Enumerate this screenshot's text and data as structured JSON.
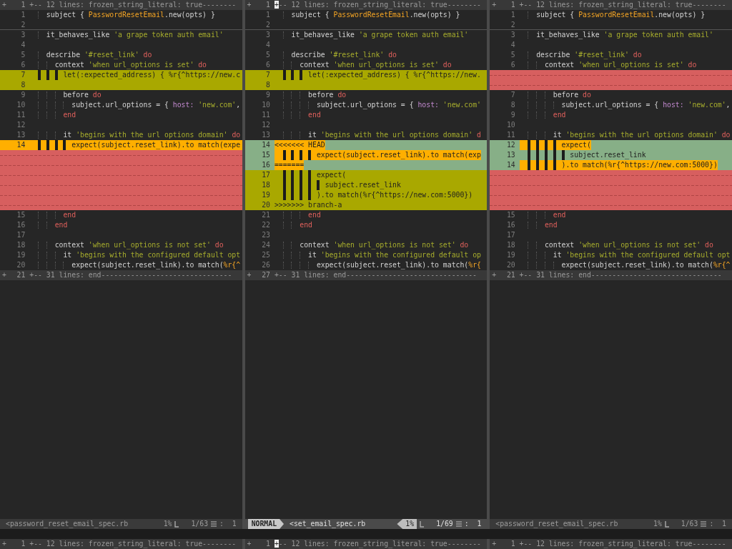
{
  "panes": [
    {
      "fold_top": {
        "marker": "+",
        "num": "1",
        "text": "+-- 12 lines: frozen_string_literal: true--------",
        "cursor": false
      },
      "lines": [
        {
          "kind": "normal",
          "num": "1",
          "tokens": [
            {
              "text": "    subject { ",
              "kind": "plain"
            },
            {
              "text": "PasswordResetEmail",
              "kind": "constant"
            },
            {
              "text": ".new(opts) }",
              "kind": "plain"
            }
          ]
        },
        {
          "kind": "normal",
          "num": "2",
          "cursor_line": true
        },
        {
          "kind": "normal",
          "num": "3",
          "tokens": [
            {
              "text": "    it_behaves_like ",
              "kind": "plain"
            },
            {
              "text": "'a grape token auth email'",
              "kind": "string"
            }
          ]
        },
        {
          "kind": "normal",
          "num": "4"
        },
        {
          "kind": "normal",
          "num": "5",
          "tokens": [
            {
              "text": "    describe ",
              "kind": "plain"
            },
            {
              "text": "'#reset_link' ",
              "kind": "string"
            },
            {
              "text": "do",
              "kind": "keyword"
            }
          ]
        },
        {
          "kind": "normal",
          "num": "6",
          "tokens": [
            {
              "text": "      context ",
              "kind": "plain"
            },
            {
              "text": "'when url_options is set' ",
              "kind": "string"
            },
            {
              "text": "do",
              "kind": "keyword"
            }
          ]
        },
        {
          "kind": "change",
          "num": "7",
          "tokens": [
            {
              "text": "        let(:expected_address) { %r{^https://new.c",
              "kind": "plain"
            }
          ]
        },
        {
          "kind": "change",
          "num": "8"
        },
        {
          "kind": "normal",
          "num": "9",
          "tokens": [
            {
              "text": "        before ",
              "kind": "plain"
            },
            {
              "text": "do",
              "kind": "keyword"
            }
          ]
        },
        {
          "kind": "normal",
          "num": "10",
          "tokens": [
            {
              "text": "          subject.url_options = { ",
              "kind": "plain"
            },
            {
              "text": "host: ",
              "kind": "symbol"
            },
            {
              "text": "'new.com'",
              "kind": "string"
            },
            {
              "text": ",",
              "kind": "plain"
            }
          ]
        },
        {
          "kind": "normal",
          "num": "11",
          "tokens": [
            {
              "text": "        end",
              "kind": "keyword"
            }
          ]
        },
        {
          "kind": "normal",
          "num": "12"
        },
        {
          "kind": "normal",
          "num": "13",
          "tokens": [
            {
              "text": "        it ",
              "kind": "plain"
            },
            {
              "text": "'begins with the url options domain' ",
              "kind": "string"
            },
            {
              "text": "do",
              "kind": "keyword"
            }
          ]
        },
        {
          "kind": "text",
          "num": "14",
          "tokens": [
            {
              "text": "          expect(subject.reset_link).to match(expe",
              "kind": "plain"
            }
          ]
        },
        {
          "kind": "filler"
        },
        {
          "kind": "filler"
        },
        {
          "kind": "filler"
        },
        {
          "kind": "filler"
        },
        {
          "kind": "filler"
        },
        {
          "kind": "filler"
        },
        {
          "kind": "normal",
          "num": "15",
          "tokens": [
            {
              "text": "        end",
              "kind": "keyword"
            }
          ]
        },
        {
          "kind": "normal",
          "num": "16",
          "tokens": [
            {
              "text": "      end",
              "kind": "keyword"
            }
          ]
        },
        {
          "kind": "normal",
          "num": "17"
        },
        {
          "kind": "normal",
          "num": "18",
          "tokens": [
            {
              "text": "      context ",
              "kind": "plain"
            },
            {
              "text": "'when url_options is not set' ",
              "kind": "string"
            },
            {
              "text": "do",
              "kind": "keyword"
            }
          ]
        },
        {
          "kind": "normal",
          "num": "19",
          "tokens": [
            {
              "text": "        it ",
              "kind": "plain"
            },
            {
              "text": "'begins with the configured default opt",
              "kind": "string"
            }
          ]
        },
        {
          "kind": "normal",
          "num": "20",
          "tokens": [
            {
              "text": "          expect(subject.reset_link).to match(",
              "kind": "plain"
            },
            {
              "text": "%r{^",
              "kind": "constant"
            }
          ]
        }
      ],
      "fold_bottom": {
        "marker": "+",
        "num": "21",
        "text": "+-- 31 lines: end-------------------------------",
        "cursor": false
      },
      "status": {
        "active": false,
        "file": "<password_reset_email_spec.rb",
        "percent": "1%",
        "position": "1/63",
        "column": ":  1"
      }
    },
    {
      "fold_top": {
        "marker": "+",
        "num": "1",
        "text": "+-- 12 lines: frozen_string_literal: true--------",
        "cursor": true
      },
      "lines": [
        {
          "kind": "normal",
          "num": "1",
          "tokens": [
            {
              "text": "    subject { ",
              "kind": "plain"
            },
            {
              "text": "PasswordResetEmail",
              "kind": "constant"
            },
            {
              "text": ".new(opts) }",
              "kind": "plain"
            }
          ]
        },
        {
          "kind": "normal",
          "num": "2",
          "cursor_line": true
        },
        {
          "kind": "normal",
          "num": "3",
          "tokens": [
            {
              "text": "    it_behaves_like ",
              "kind": "plain"
            },
            {
              "text": "'a grape token auth email'",
              "kind": "string"
            }
          ]
        },
        {
          "kind": "normal",
          "num": "4"
        },
        {
          "kind": "normal",
          "num": "5",
          "tokens": [
            {
              "text": "    describe ",
              "kind": "plain"
            },
            {
              "text": "'#reset_link' ",
              "kind": "string"
            },
            {
              "text": "do",
              "kind": "keyword"
            }
          ]
        },
        {
          "kind": "normal",
          "num": "6",
          "tokens": [
            {
              "text": "      context ",
              "kind": "plain"
            },
            {
              "text": "'when url_options is set' ",
              "kind": "string"
            },
            {
              "text": "do",
              "kind": "keyword"
            }
          ]
        },
        {
          "kind": "change",
          "num": "7",
          "tokens": [
            {
              "text": "        let(:expected_address) { %r{^https://new.",
              "kind": "plain"
            }
          ]
        },
        {
          "kind": "change",
          "num": "8"
        },
        {
          "kind": "normal",
          "num": "9",
          "tokens": [
            {
              "text": "        before ",
              "kind": "plain"
            },
            {
              "text": "do",
              "kind": "keyword"
            }
          ]
        },
        {
          "kind": "normal",
          "num": "10",
          "tokens": [
            {
              "text": "          subject.url_options = { ",
              "kind": "plain"
            },
            {
              "text": "host: ",
              "kind": "symbol"
            },
            {
              "text": "'new.com'",
              "kind": "string"
            }
          ]
        },
        {
          "kind": "normal",
          "num": "11",
          "tokens": [
            {
              "text": "        end",
              "kind": "keyword"
            }
          ]
        },
        {
          "kind": "normal",
          "num": "12"
        },
        {
          "kind": "normal",
          "num": "13",
          "tokens": [
            {
              "text": "        it ",
              "kind": "plain"
            },
            {
              "text": "'begins with the url options domain' ",
              "kind": "string"
            },
            {
              "text": "d",
              "kind": "keyword"
            }
          ]
        },
        {
          "kind": "conflict",
          "num": "14",
          "text_changed": true,
          "tokens": [
            {
              "text": "<<<<<<< HEAD",
              "kind": "plain"
            }
          ]
        },
        {
          "kind": "conflict",
          "num": "15",
          "text_changed": true,
          "tokens": [
            {
              "text": "          expect(subject.reset_link).to match(exp",
              "kind": "plain"
            }
          ]
        },
        {
          "kind": "conflict",
          "num": "16",
          "text_changed": true,
          "tokens": [
            {
              "text": "=======",
              "kind": "plain"
            }
          ]
        },
        {
          "kind": "change",
          "num": "17",
          "tokens": [
            {
              "text": "          expect(",
              "kind": "plain"
            }
          ]
        },
        {
          "kind": "change",
          "num": "18",
          "tokens": [
            {
              "text": "            subject.reset_link",
              "kind": "plain"
            }
          ]
        },
        {
          "kind": "change",
          "num": "19",
          "tokens": [
            {
              "text": "          ).to match(%r{^https://new.com:5000})",
              "kind": "plain"
            }
          ]
        },
        {
          "kind": "change",
          "num": "20",
          "tokens": [
            {
              "text": ">>>>>>> branch-a",
              "kind": "plain"
            }
          ]
        },
        {
          "kind": "normal",
          "num": "21",
          "tokens": [
            {
              "text": "        end",
              "kind": "keyword"
            }
          ]
        },
        {
          "kind": "normal",
          "num": "22",
          "tokens": [
            {
              "text": "      end",
              "kind": "keyword"
            }
          ]
        },
        {
          "kind": "normal",
          "num": "23"
        },
        {
          "kind": "normal",
          "num": "24",
          "tokens": [
            {
              "text": "      context ",
              "kind": "plain"
            },
            {
              "text": "'when url_options is not set' ",
              "kind": "string"
            },
            {
              "text": "do",
              "kind": "keyword"
            }
          ]
        },
        {
          "kind": "normal",
          "num": "25",
          "tokens": [
            {
              "text": "        it ",
              "kind": "plain"
            },
            {
              "text": "'begins with the configured default op",
              "kind": "string"
            }
          ]
        },
        {
          "kind": "normal",
          "num": "26",
          "tokens": [
            {
              "text": "          expect(subject.reset_link).to match(",
              "kind": "plain"
            },
            {
              "text": "%r{",
              "kind": "constant"
            }
          ]
        }
      ],
      "fold_bottom": {
        "marker": "+",
        "num": "27",
        "text": "+-- 31 lines: end-------------------------------",
        "cursor": false
      },
      "status": {
        "active": true,
        "mode": "NORMAL",
        "file": "<set_email_spec.rb",
        "percent": "1%",
        "position": "1/69",
        "column": ":  1"
      }
    },
    {
      "fold_top": {
        "marker": "+",
        "num": "1",
        "text": "+-- 12 lines: frozen_string_literal: true--------",
        "cursor": false
      },
      "lines": [
        {
          "kind": "normal",
          "num": "1",
          "tokens": [
            {
              "text": "    subject { ",
              "kind": "plain"
            },
            {
              "text": "PasswordResetEmail",
              "kind": "constant"
            },
            {
              "text": ".new(opts) }",
              "kind": "plain"
            }
          ]
        },
        {
          "kind": "normal",
          "num": "2",
          "cursor_line": true
        },
        {
          "kind": "normal",
          "num": "3",
          "tokens": [
            {
              "text": "    it_behaves_like ",
              "kind": "plain"
            },
            {
              "text": "'a grape token auth email'",
              "kind": "string"
            }
          ]
        },
        {
          "kind": "normal",
          "num": "4"
        },
        {
          "kind": "normal",
          "num": "5",
          "tokens": [
            {
              "text": "    describe ",
              "kind": "plain"
            },
            {
              "text": "'#reset_link' ",
              "kind": "string"
            },
            {
              "text": "do",
              "kind": "keyword"
            }
          ]
        },
        {
          "kind": "normal",
          "num": "6",
          "tokens": [
            {
              "text": "      context ",
              "kind": "plain"
            },
            {
              "text": "'when url_options is set' ",
              "kind": "string"
            },
            {
              "text": "do",
              "kind": "keyword"
            }
          ]
        },
        {
          "kind": "filler"
        },
        {
          "kind": "filler"
        },
        {
          "kind": "normal",
          "num": "7",
          "tokens": [
            {
              "text": "        before ",
              "kind": "plain"
            },
            {
              "text": "do",
              "kind": "keyword"
            }
          ]
        },
        {
          "kind": "normal",
          "num": "8",
          "tokens": [
            {
              "text": "          subject.url_options = { ",
              "kind": "plain"
            },
            {
              "text": "host: ",
              "kind": "symbol"
            },
            {
              "text": "'new.com'",
              "kind": "string"
            },
            {
              "text": ",",
              "kind": "plain"
            }
          ]
        },
        {
          "kind": "normal",
          "num": "9",
          "tokens": [
            {
              "text": "        end",
              "kind": "keyword"
            }
          ]
        },
        {
          "kind": "normal",
          "num": "10"
        },
        {
          "kind": "normal",
          "num": "11",
          "tokens": [
            {
              "text": "        it ",
              "kind": "plain"
            },
            {
              "text": "'begins with the url options domain' ",
              "kind": "string"
            },
            {
              "text": "do",
              "kind": "keyword"
            }
          ]
        },
        {
          "kind": "conflict",
          "num": "12",
          "text_changed": true,
          "tokens": [
            {
              "text": "          expect(",
              "kind": "plain"
            }
          ]
        },
        {
          "kind": "conflict",
          "num": "13",
          "text_changed": false,
          "tokens": [
            {
              "text": "            subject.reset_link",
              "kind": "plain"
            }
          ]
        },
        {
          "kind": "conflict",
          "num": "14",
          "text_changed": true,
          "tokens": [
            {
              "text": "          ).to match(%r{^https://new.com:5000})",
              "kind": "plain"
            }
          ]
        },
        {
          "kind": "filler"
        },
        {
          "kind": "filler"
        },
        {
          "kind": "filler"
        },
        {
          "kind": "filler"
        },
        {
          "kind": "normal",
          "num": "15",
          "tokens": [
            {
              "text": "        end",
              "kind": "keyword"
            }
          ]
        },
        {
          "kind": "normal",
          "num": "16",
          "tokens": [
            {
              "text": "      end",
              "kind": "keyword"
            }
          ]
        },
        {
          "kind": "normal",
          "num": "17"
        },
        {
          "kind": "normal",
          "num": "18",
          "tokens": [
            {
              "text": "      context ",
              "kind": "plain"
            },
            {
              "text": "'when url_options is not set' ",
              "kind": "string"
            },
            {
              "text": "do",
              "kind": "keyword"
            }
          ]
        },
        {
          "kind": "normal",
          "num": "19",
          "tokens": [
            {
              "text": "        it ",
              "kind": "plain"
            },
            {
              "text": "'begins with the configured default opt",
              "kind": "string"
            }
          ]
        },
        {
          "kind": "normal",
          "num": "20",
          "tokens": [
            {
              "text": "          expect(subject.reset_link).to match(",
              "kind": "plain"
            },
            {
              "text": "%r{^",
              "kind": "constant"
            }
          ]
        }
      ],
      "fold_bottom": {
        "marker": "+",
        "num": "21",
        "text": "+-- 31 lines: end-------------------------------",
        "cursor": false
      },
      "status": {
        "active": false,
        "file": "<password_reset_email_spec.rb",
        "percent": "1%",
        "position": "1/63",
        "column": ":  1"
      }
    }
  ],
  "next_window": {
    "folds": [
      {
        "marker": "+",
        "num": "1",
        "text": "+-- 12 lines: frozen_string_literal: true--------",
        "cursor": false
      },
      {
        "marker": "+",
        "num": "1",
        "text": "+-- 12 lines: frozen_string_literal: true--------",
        "cursor": true
      },
      {
        "marker": "+",
        "num": "1",
        "text": "+-- 12 lines: frozen_string_literal: true--------",
        "cursor": false
      }
    ]
  }
}
